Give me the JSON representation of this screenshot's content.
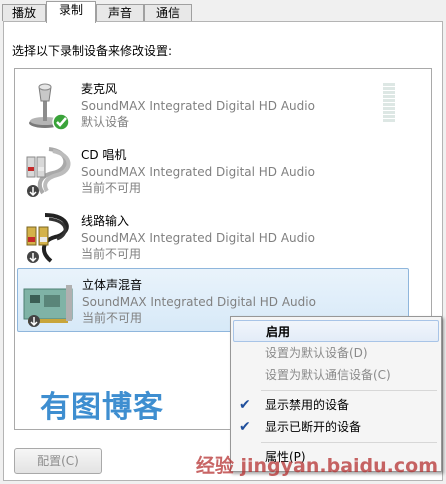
{
  "tabs": [
    "播放",
    "录制",
    "声音",
    "通信"
  ],
  "instruction": "选择以下录制设备来修改设置:",
  "devices": [
    {
      "name": "麦克风",
      "description": "SoundMAX Integrated Digital HD Audio",
      "status": "默认设备",
      "icon": "microphone-icon"
    },
    {
      "name": "CD 唱机",
      "description": "SoundMAX Integrated Digital HD Audio",
      "status": "当前不可用",
      "icon": "cd-cable-icon"
    },
    {
      "name": "线路输入",
      "description": "SoundMAX Integrated Digital HD Audio",
      "status": "当前不可用",
      "icon": "line-in-cable-icon"
    },
    {
      "name": "立体声混音",
      "description": "SoundMAX Integrated Digital HD Audio",
      "status": "当前不可用",
      "icon": "sound-card-icon"
    }
  ],
  "configure_button": "配置(C)",
  "context_menu": [
    {
      "label": "启用",
      "checked": false,
      "state": "bold"
    },
    {
      "label": "设置为默认设备(D)",
      "checked": false,
      "state": "disabled"
    },
    {
      "label": "设置为默认通信设备(C)",
      "checked": false,
      "state": "disabled"
    },
    {
      "label": "显示禁用的设备",
      "checked": true,
      "state": "normal"
    },
    {
      "label": "显示已断开的设备",
      "checked": true,
      "state": "normal"
    },
    {
      "label": "属性(P)",
      "checked": false,
      "state": "normal"
    }
  ],
  "watermark_text": "有图博客",
  "corner_watermark": "经验 jingyan.baidu.com",
  "colors": {
    "selection": "#d7e9f8",
    "watermark": "#3e8ed0",
    "check": "#1f4f9c"
  }
}
